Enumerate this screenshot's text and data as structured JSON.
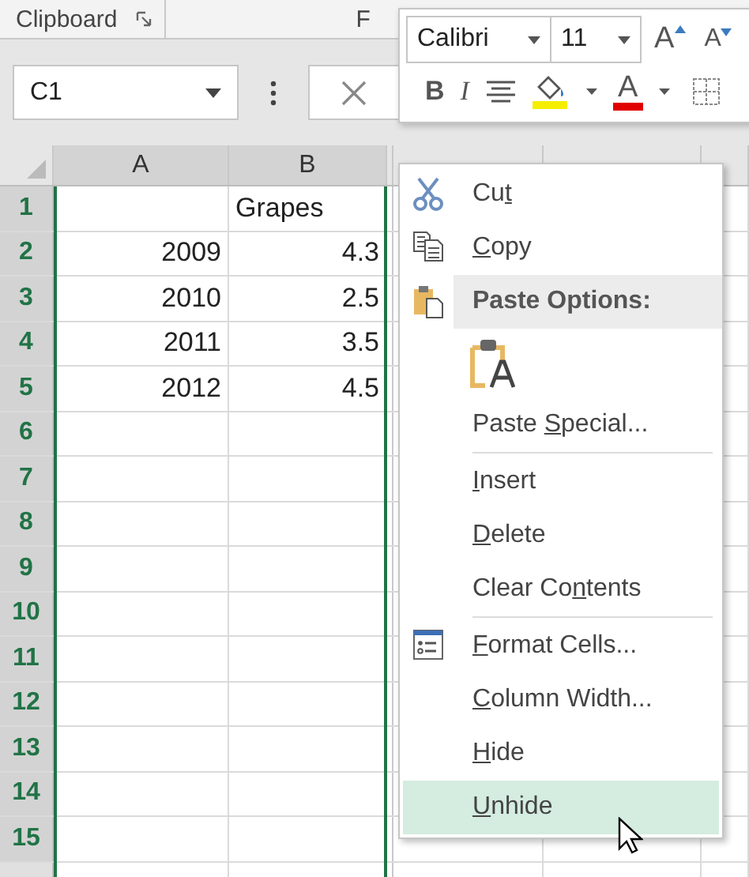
{
  "ribbon": {
    "groups": [
      {
        "label": "Clipboard",
        "launcher": true
      },
      {
        "label": "F"
      }
    ]
  },
  "formula_bar": {
    "name_box": "C1"
  },
  "sheet": {
    "columns": [
      {
        "label": "A",
        "selected": true
      },
      {
        "label": "B",
        "selected": true
      }
    ],
    "rows": [
      {
        "header": "1",
        "cells": [
          null,
          {
            "text": "Grapes",
            "kind": "text"
          }
        ]
      },
      {
        "header": "2",
        "cells": [
          {
            "text": "2009",
            "kind": "number"
          },
          {
            "text": "4.3",
            "kind": "number"
          }
        ]
      },
      {
        "header": "3",
        "cells": [
          {
            "text": "2010",
            "kind": "number"
          },
          {
            "text": "2.5",
            "kind": "number"
          }
        ]
      },
      {
        "header": "4",
        "cells": [
          {
            "text": "2011",
            "kind": "number"
          },
          {
            "text": "3.5",
            "kind": "number"
          }
        ]
      },
      {
        "header": "5",
        "cells": [
          {
            "text": "2012",
            "kind": "number"
          },
          {
            "text": "4.5",
            "kind": "number"
          }
        ]
      },
      {
        "header": "6"
      },
      {
        "header": "7"
      },
      {
        "header": "8"
      },
      {
        "header": "9"
      },
      {
        "header": "10"
      },
      {
        "header": "11"
      },
      {
        "header": "12"
      },
      {
        "header": "13"
      },
      {
        "header": "14"
      },
      {
        "header": "15"
      }
    ]
  },
  "mini_toolbar": {
    "font": "Calibri",
    "size": "11",
    "grow": "A",
    "shrink": "A",
    "bold": "B",
    "italic": "I",
    "font_color": "A"
  },
  "context_menu": [
    {
      "kind": "cut",
      "before": "Cu",
      "key": "t",
      "selected": false
    },
    {
      "kind": "copy",
      "key": "C",
      "after": "opy",
      "selected": false
    },
    {
      "kind": "paste-header",
      "label": "Paste Options:"
    },
    {
      "kind": "paste-option"
    },
    {
      "kind": "plain",
      "before": "Paste ",
      "key": "S",
      "after": "pecial...",
      "selected": false
    },
    {
      "kind": "separator"
    },
    {
      "kind": "plain",
      "key": "I",
      "after": "nsert",
      "selected": false
    },
    {
      "kind": "plain",
      "key": "D",
      "after": "elete",
      "selected": false
    },
    {
      "kind": "plain",
      "before": "Clear Co",
      "key": "n",
      "after": "tents",
      "selected": false
    },
    {
      "kind": "separator"
    },
    {
      "kind": "format",
      "key": "F",
      "after": "ormat Cells...",
      "selected": false
    },
    {
      "kind": "plain",
      "key": "C",
      "after": "olumn Width...",
      "selected": false
    },
    {
      "kind": "plain",
      "key": "H",
      "after": "ide",
      "selected": false
    },
    {
      "kind": "plain",
      "key": "U",
      "after": "nhide",
      "selected": true
    }
  ]
}
